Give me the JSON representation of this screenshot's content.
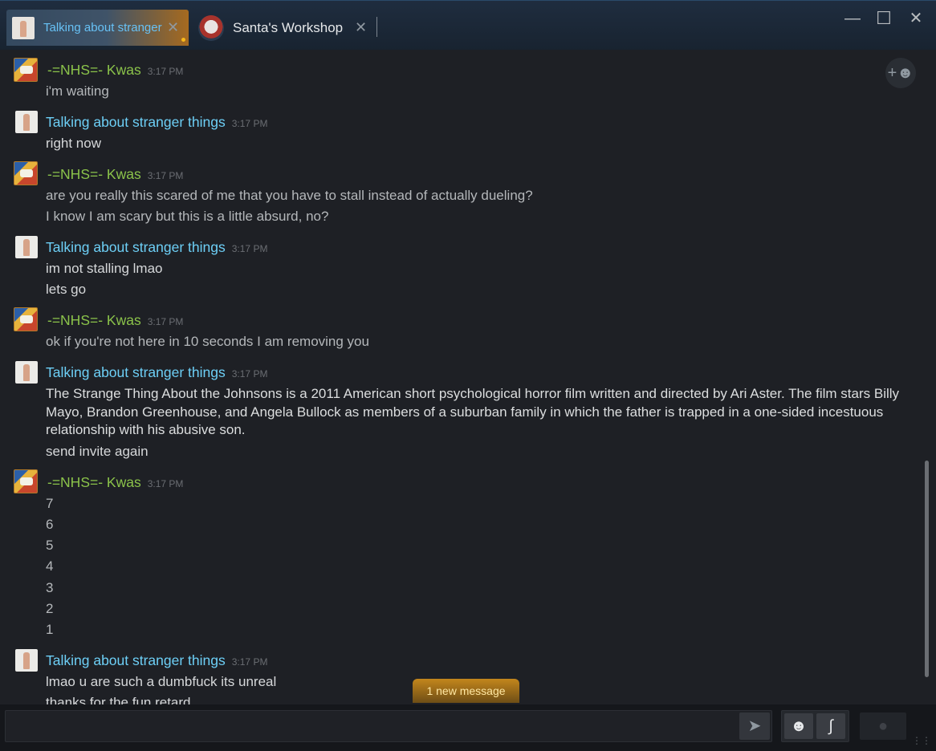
{
  "tabs": [
    {
      "title": "Talking about stranger things",
      "close": "✕",
      "active": true
    },
    {
      "title": "Santa's Workshop",
      "close": "✕",
      "active": false
    }
  ],
  "window_controls": {
    "minimize": "—",
    "maximize": "☐",
    "close": "✕"
  },
  "chat": {
    "groups": [
      {
        "sender": "-=NHS=- Kwas",
        "time": "3:17 PM",
        "lines": [
          "i'm waiting"
        ]
      },
      {
        "sender": "Talking about stranger things",
        "time": "3:17 PM",
        "lines": [
          "right now"
        ]
      },
      {
        "sender": "-=NHS=- Kwas",
        "time": "3:17 PM",
        "lines": [
          "are you really this scared of me that you have to stall instead of actually dueling?",
          "I know I am scary but this is a little absurd, no?"
        ]
      },
      {
        "sender": "Talking about stranger things",
        "time": "3:17 PM",
        "lines": [
          "im not stalling lmao",
          "lets go"
        ]
      },
      {
        "sender": "-=NHS=- Kwas",
        "time": "3:17 PM",
        "lines": [
          "ok if you're not here in 10 seconds I am removing you"
        ]
      },
      {
        "sender": "Talking about stranger things",
        "time": "3:17 PM",
        "lines": [
          "The Strange Thing About the Johnsons is a 2011 American short psychological horror film written and directed by Ari Aster. The film stars Billy Mayo, Brandon Greenhouse, and Angela Bullock as members of a suburban family in which the father is trapped in a one-sided incestuous relationship with his abusive son.",
          "send invite again"
        ]
      },
      {
        "sender": "-=NHS=- Kwas",
        "time": "3:17 PM",
        "lines": [
          "7",
          "6",
          "5",
          "4",
          "3",
          "2",
          "1"
        ]
      },
      {
        "sender": "Talking about stranger things",
        "time": "3:17 PM",
        "lines": [
          "lmao u are such a dumbfuck its unreal",
          "thanks for the fun retard"
        ]
      }
    ],
    "new_message_label": "1 new message"
  },
  "input": {
    "value": "",
    "placeholder": ""
  },
  "icons": {
    "add_friend": "person-add-icon",
    "send": "send-arrow-icon",
    "emoji": "emoji-icon",
    "attach": "paperclip-icon",
    "mic": "microphone-icon"
  },
  "colors": {
    "kwas_name": "#8bc34a",
    "stranger_name": "#6dcff6",
    "new_message_badge": "#c3861c",
    "background": "#1e2025"
  }
}
